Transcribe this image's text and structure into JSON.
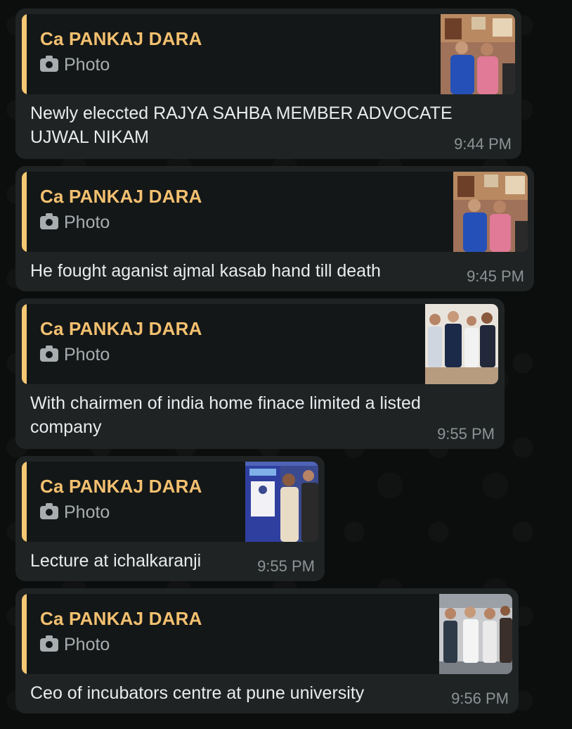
{
  "messages": [
    {
      "sender": "Ca PANKAJ DARA",
      "quote_type": "Photo",
      "text": "Newly eleccted RAJYA SAHBA MEMBER ADVOCATE UJWAL NIKAM",
      "time": "9:44 PM",
      "photo": "two-men-office"
    },
    {
      "sender": "Ca PANKAJ DARA",
      "quote_type": "Photo",
      "text": "He fought aganist ajmal kasab hand till death",
      "time": "9:45 PM",
      "photo": "two-men-office"
    },
    {
      "sender": "Ca PANKAJ DARA",
      "quote_type": "Photo",
      "text": "With chairmen of india home finace limited a listed company",
      "time": "9:55 PM",
      "photo": "four-men-group"
    },
    {
      "sender": "Ca PANKAJ DARA",
      "quote_type": "Photo",
      "text": "Lecture at ichalkaranji",
      "time": "9:55 PM",
      "photo": "lecture-banner"
    },
    {
      "sender": "Ca PANKAJ DARA",
      "quote_type": "Photo",
      "text": "Ceo of incubators centre at pune university",
      "time": "9:56 PM",
      "photo": "four-men-office"
    }
  ]
}
